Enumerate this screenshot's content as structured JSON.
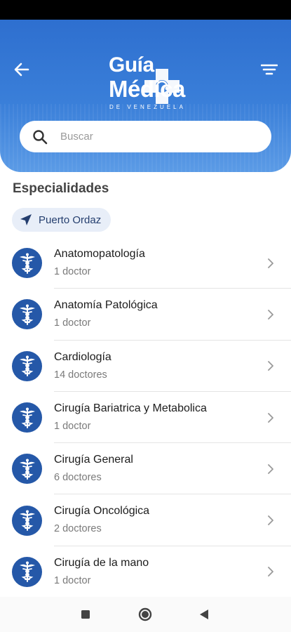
{
  "header": {
    "logo_line1": "Guía",
    "logo_line2": "Médica",
    "logo_sub": "DE VENEZUELA"
  },
  "search": {
    "placeholder": "Buscar"
  },
  "section": {
    "title": "Especialidades"
  },
  "location": {
    "label": "Puerto Ordaz"
  },
  "specialties": [
    {
      "name": "Anatomopatología",
      "count": "1 doctor"
    },
    {
      "name": "Anatomía Patológica",
      "count": "1 doctor"
    },
    {
      "name": "Cardiología",
      "count": "14 doctores"
    },
    {
      "name": "Cirugía Bariatrica y Metabolica",
      "count": "1 doctor"
    },
    {
      "name": "Cirugía General",
      "count": "6 doctores"
    },
    {
      "name": "Cirugía Oncológica",
      "count": "2 doctores"
    },
    {
      "name": "Cirugía de la mano",
      "count": "1 doctor"
    }
  ],
  "icons": {
    "back": "arrow-left-icon",
    "filter": "filter-icon",
    "search": "search-icon",
    "location": "navigation-arrow-icon",
    "specialty": "caduceus-icon",
    "chevron": "chevron-right-icon"
  },
  "colors": {
    "primary": "#2e6fcf",
    "avatar": "#2558a8",
    "chip": "#e8eef8"
  }
}
